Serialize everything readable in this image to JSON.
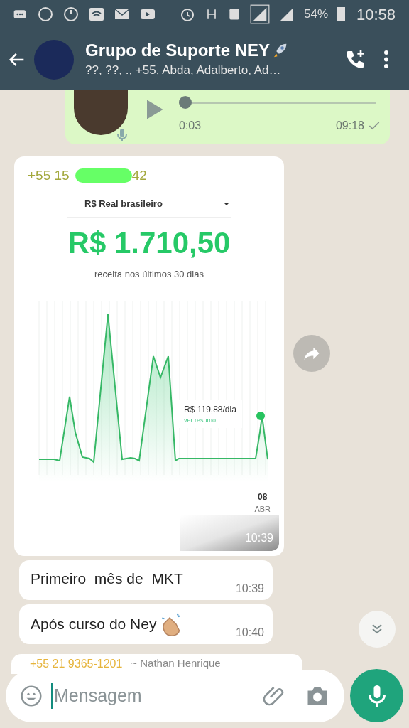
{
  "status_bar": {
    "battery": "54%",
    "time": "10:58"
  },
  "header": {
    "title": "Grupo de Suporte NEY",
    "subtitle": "??, ??, ., +55, Abda, Adalberto, Ad…"
  },
  "messages": [
    {
      "kind": "voice",
      "duration": "0:03",
      "time": "09:18",
      "level": 0
    },
    {
      "kind": "image",
      "sender": "+55 15",
      "sender_end": "42",
      "time": "10:39",
      "image": {
        "currency": "R$ Real brasileiro",
        "amount": "R$ 1.710,50",
        "caption": "receita nos últimos 30 dias",
        "tooltip_value": "R$ 119,88/dia",
        "tooltip_link": "ver resumo",
        "day": "08",
        "month": "ABR"
      }
    },
    {
      "kind": "text",
      "text": "Primeiro  mês de  MKT",
      "time": "10:39",
      "clapping_emoji": false
    },
    {
      "kind": "text",
      "text": "Após curso do Ney",
      "time": "10:40",
      "clapping_emoji": true
    },
    {
      "kind": "partial",
      "sender": "+55 21 9365-1201",
      "sender_name": "~ Nathan Henrique"
    }
  ],
  "input": {
    "placeholder": "Mensagem"
  }
}
